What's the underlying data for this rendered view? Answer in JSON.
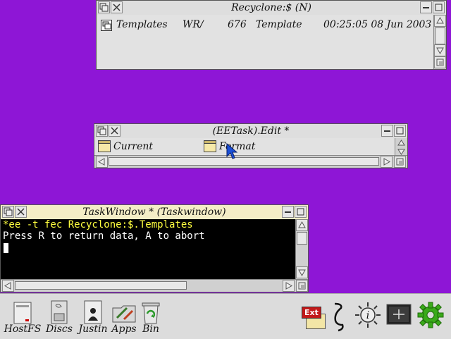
{
  "filer": {
    "title": "Recyclone:$ (N)",
    "row": {
      "name": "Templates",
      "access": "WR/",
      "size": "676",
      "type": "Template",
      "date": "00:25:05 08 Jun 2003"
    }
  },
  "editor": {
    "title": "(EETask).Edit *",
    "items": [
      "Current",
      "Format"
    ]
  },
  "taskwindow": {
    "title": "TaskWindow * (Taskwindow)",
    "command": "*ee -t fec Recyclone:$.Templates",
    "message": "Press R to return data, A to abort"
  },
  "iconbar": {
    "left": [
      {
        "label": "HostFS"
      },
      {
        "label": "Discs"
      },
      {
        "label": "Justin"
      },
      {
        "label": "Apps"
      },
      {
        "label": "Bin"
      }
    ],
    "ext_label": "Ext"
  },
  "colors": {
    "desktop": "#8e16d6",
    "window_bg": "#e2e2e2",
    "active_title": "#f4edc6",
    "task_bg": "#000000",
    "task_text": "#ffffff",
    "task_command": "#ffff40"
  }
}
